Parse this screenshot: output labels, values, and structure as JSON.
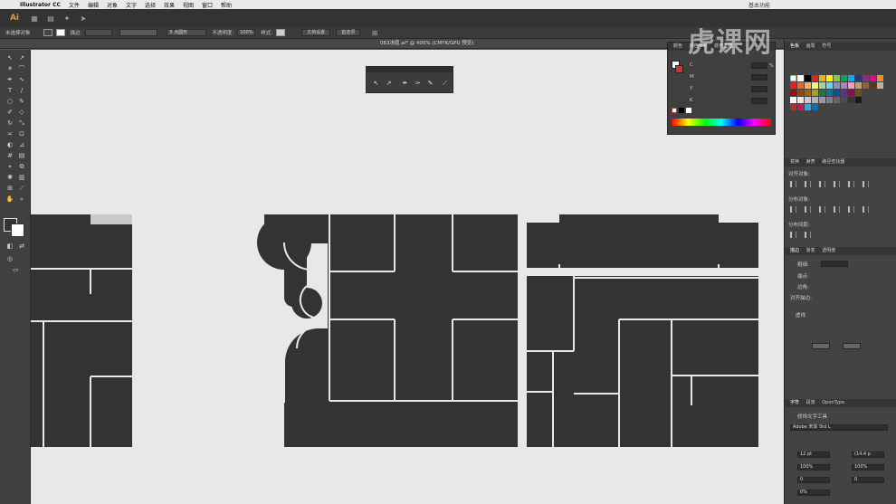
{
  "menubar": {
    "app_name": "Illustrator CC",
    "items": [
      "文件",
      "编辑",
      "对象",
      "文字",
      "选择",
      "效果",
      "视图",
      "窗口",
      "帮助"
    ],
    "workspace": "基本功能"
  },
  "topbar": {
    "logo": "Ai"
  },
  "control_bar": {
    "no_selection": "未选择对象",
    "stroke_label": "描边:",
    "brush_label": "5 点圆形",
    "opacity_label": "不透明度:",
    "opacity_value": "100%",
    "style_label": "样式:",
    "doc_setup": "文档设置",
    "preferences": "首选项"
  },
  "document_tab": {
    "title": "083决庭.ai* @ 400% (CMYK/GPU 预览)"
  },
  "color_panel": {
    "tabs": [
      "颜色",
      "颜色参考",
      "颜色主题"
    ],
    "channels": [
      "C",
      "M",
      "Y",
      "K"
    ],
    "values": [
      "",
      "",
      "",
      ""
    ],
    "percent": "%"
  },
  "right_panel": {
    "swatch_tabs": [
      "色板",
      "画笔",
      "符号"
    ],
    "align_tabs": [
      "变换",
      "对齐",
      "路径查找器"
    ],
    "align_objects": "对齐对象:",
    "distribute_objects": "分布对象:",
    "distribute_spacing": "分布间距:",
    "stroke_tabs": [
      "描边",
      "渐变",
      "透明度"
    ],
    "weight_label": "粗细:",
    "cap_label": "端点:",
    "corner_label": "边角:",
    "align_stroke_label": "对齐描边:",
    "dashed_label": "虚线",
    "char_tabs": [
      "字符",
      "段落",
      "OpenType"
    ],
    "touch_type": "修饰文字工具",
    "font_family": "Adobe 宋体 Std L",
    "font_size": "12 pt",
    "leading": "(14.4 p",
    "scale_h": "100%",
    "scale_v": "100%",
    "tracking": "0",
    "kerning": "0",
    "tsume": "0%"
  },
  "watermark": "虎课网",
  "colors": {
    "glyph": "#333333",
    "canvas": "#e8e8e8",
    "ui_dark": "#3b3b3b",
    "accent": "#e39c3b"
  }
}
